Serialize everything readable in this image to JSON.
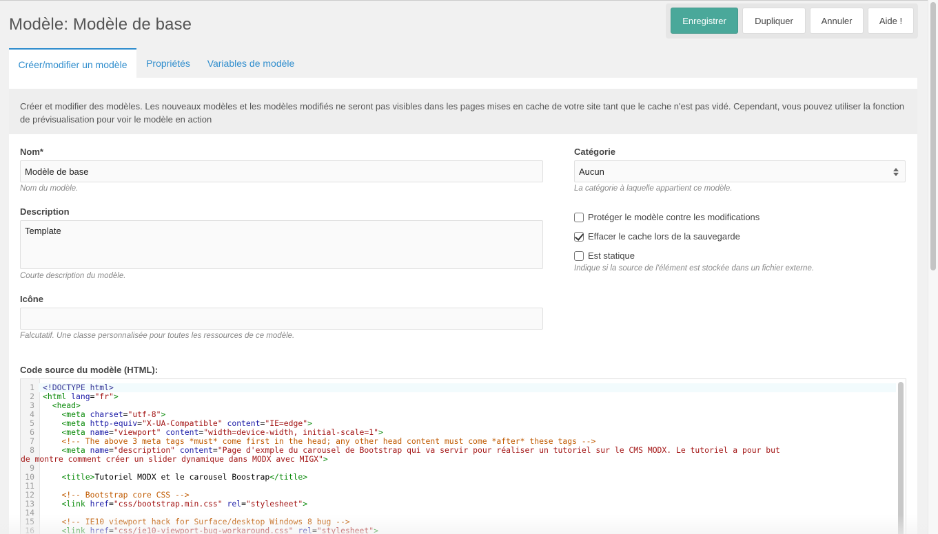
{
  "header": {
    "title": "Modèle: Modèle de base",
    "buttons": {
      "save": "Enregistrer",
      "duplicate": "Dupliquer",
      "cancel": "Annuler",
      "help": "Aide !"
    }
  },
  "tabs": [
    {
      "label": "Créer/modifier un modèle"
    },
    {
      "label": "Propriétés"
    },
    {
      "label": "Variables de modèle"
    }
  ],
  "intro": "Créer et modifier des modèles. Les nouveaux modèles et les modèles modifiés ne seront pas visibles dans les pages mises en cache de votre site tant que le cache n'est pas vidé. Cependant, vous pouvez utiliser la fonction de prévisualisation pour voir le modèle en action",
  "form": {
    "name": {
      "label": "Nom*",
      "value": "Modèle de base",
      "help": "Nom du modèle."
    },
    "description": {
      "label": "Description",
      "value": "Template",
      "help": "Courte description du modèle."
    },
    "icon": {
      "label": "Icône",
      "value": "",
      "help": "Falcutatif. Une classe personnalisée pour toutes les ressources de ce modèle."
    },
    "category": {
      "label": "Catégorie",
      "value": "Aucun",
      "help": "La catégorie à laquelle appartient ce modèle."
    },
    "checkboxes": {
      "lock": {
        "label": "Protéger le modèle contre les modifications",
        "checked": false
      },
      "clear_cache": {
        "label": "Effacer le cache lors de la sauvegarde",
        "checked": true
      },
      "static": {
        "label": "Est statique",
        "checked": false
      }
    },
    "static_help": "Indique si la source de l'élément est stockée dans un fichier externe.",
    "code_label": "Code source du modèle (HTML):"
  },
  "code": {
    "line_numbers": [
      "1",
      "2",
      "3",
      "4",
      "5",
      "6",
      "7",
      "8",
      "",
      "9",
      "10",
      "11",
      "12",
      "13",
      "14",
      "15",
      "16"
    ],
    "l1": "<!DOCTYPE html>",
    "l2_open": "<html",
    "l2_attr": " lang",
    "l2_eq": "=",
    "l2_val": "\"fr\"",
    "l2_close": ">",
    "l3": "<head>",
    "l4": {
      "tag": "<meta",
      "a1": " charset",
      "v1": "\"utf-8\"",
      "end": ">"
    },
    "l5": {
      "tag": "<meta",
      "a1": " http-equiv",
      "v1": "\"X-UA-Compatible\"",
      "a2": " content",
      "v2": "\"IE=edge\"",
      "end": ">"
    },
    "l6": {
      "tag": "<meta",
      "a1": " name",
      "v1": "\"viewport\"",
      "a2": " content",
      "v2": "\"width=device-width, initial-scale=1\"",
      "end": ">"
    },
    "l7": "<!-- The above 3 meta tags *must* come first in the head; any other head content must come *after* these tags -->",
    "l8": {
      "tag": "<meta",
      "a1": " name",
      "v1": "\"description\"",
      "a2": " content",
      "v2": "\"Page d'exmple du carousel de Bootstrap qui va servir pour réaliser un tutoriel sur le CMS MODX. Le tutoriel a pour but",
      "end": ""
    },
    "l8b": {
      "v": "de montre comment créer un slider dynamique dans MODX avec MIGX\"",
      "end": ">"
    },
    "l10": {
      "open": "<title>",
      "text": "Tutoriel MODX et le carousel Boostrap",
      "close": "</title>"
    },
    "l12": "<!-- Bootstrap core CSS -->",
    "l13": {
      "tag": "<link",
      "a1": " href",
      "v1": "\"css/bootstrap.min.css\"",
      "a2": " rel",
      "v2": "\"stylesheet\"",
      "end": ">"
    },
    "l15": "<!-- IE10 viewport hack for Surface/desktop Windows 8 bug -->",
    "l16": {
      "tag": "<link",
      "a1": " href",
      "v1": "\"css/ie10-viewport-bug-workaround.css\"",
      "a2": " rel",
      "v2": "\"stylesheet\"",
      "end": ">"
    }
  }
}
